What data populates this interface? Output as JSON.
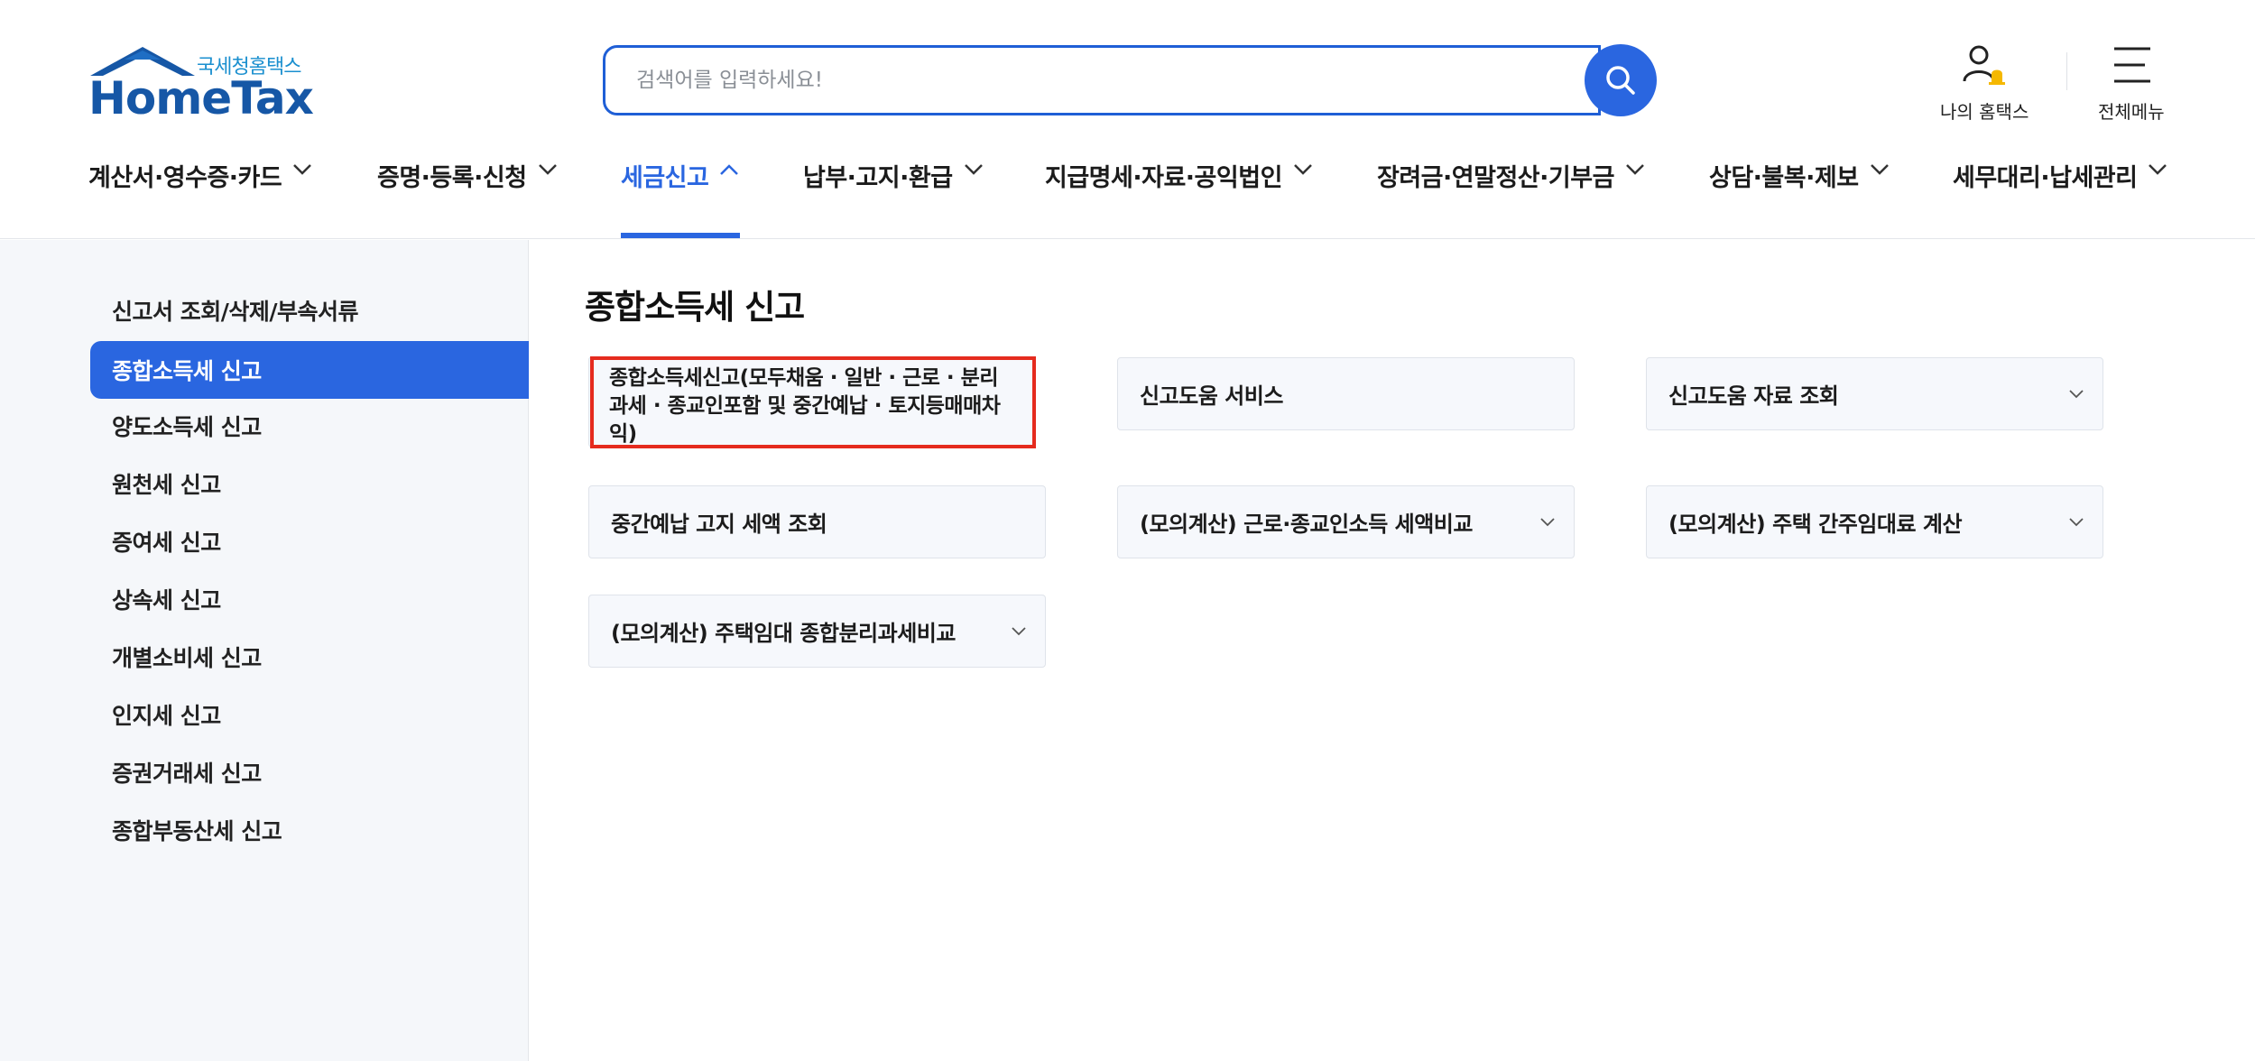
{
  "header": {
    "logo_sub": "국세청홈택스",
    "logo_main": "HomeTax",
    "search": {
      "placeholder": "검색어를 입력하세요!"
    },
    "utils": [
      {
        "label": "나의 홈택스",
        "icon": "user-bell-icon"
      },
      {
        "label": "전체메뉴",
        "icon": "hamburger-menu-icon"
      }
    ]
  },
  "gnb": [
    {
      "label": "계산서·영수증·카드",
      "active": false
    },
    {
      "label": "증명·등록·신청",
      "active": false
    },
    {
      "label": "세금신고",
      "active": true
    },
    {
      "label": "납부·고지·환급",
      "active": false
    },
    {
      "label": "지급명세·자료·공익법인",
      "active": false
    },
    {
      "label": "장려금·연말정산·기부금",
      "active": false
    },
    {
      "label": "상담·불복·제보",
      "active": false
    },
    {
      "label": "세무대리·납세관리",
      "active": false
    }
  ],
  "sidebar": {
    "items": [
      {
        "label": "신고서 조회/삭제/부속서류"
      },
      {
        "label": "종합소득세 신고"
      },
      {
        "label": "양도소득세 신고"
      },
      {
        "label": "원천세 신고"
      },
      {
        "label": "증여세 신고"
      },
      {
        "label": "상속세 신고"
      },
      {
        "label": "개별소비세 신고"
      },
      {
        "label": "인지세 신고"
      },
      {
        "label": "증권거래세 신고"
      },
      {
        "label": "종합부동산세 신고"
      }
    ],
    "active_index": 1
  },
  "main": {
    "title": "종합소득세 신고",
    "cards": [
      {
        "label": "종합소득세신고(모두채움 · 일반 · 근로 · 분리과세 · 종교인포함 및 중간예납 · 토지등매매차익)",
        "has_dropdown": false
      },
      {
        "label": "신고도움 서비스",
        "has_dropdown": false
      },
      {
        "label": "신고도움 자료 조회",
        "has_dropdown": true
      },
      {
        "label": "중간예납 고지 세액 조회",
        "has_dropdown": false
      },
      {
        "label": "(모의계산) 근로·종교인소득 세액비교",
        "has_dropdown": true
      },
      {
        "label": "(모의계산) 주택 간주임대료 계산",
        "has_dropdown": true
      },
      {
        "label": "(모의계산) 주택임대 종합분리과세비교",
        "has_dropdown": true
      }
    ]
  },
  "colors": {
    "brand_blue": "#2a66e0",
    "logo_blue": "#1657a6",
    "highlight_red": "#e52b1e",
    "sidebar_bg": "#f5f7fa"
  }
}
